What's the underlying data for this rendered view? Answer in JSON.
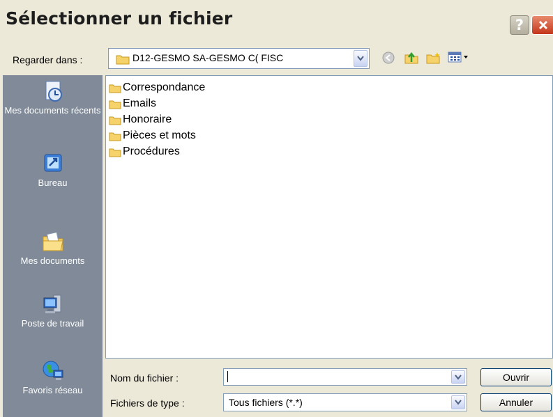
{
  "window": {
    "title": "Sélectionner un fichier"
  },
  "lookin": {
    "label": "Regarder dans :",
    "value": "D12-GESMO SA-GESMO  C( FISC"
  },
  "places": [
    {
      "label": "Mes documents récents",
      "icon": "recent-documents-icon"
    },
    {
      "label": "Bureau",
      "icon": "desktop-icon"
    },
    {
      "label": "Mes documents",
      "icon": "my-documents-icon"
    },
    {
      "label": "Poste de travail",
      "icon": "my-computer-icon"
    },
    {
      "label": "Favoris réseau",
      "icon": "network-places-icon"
    }
  ],
  "files": [
    {
      "name": "Correspondance",
      "icon": "folder-icon"
    },
    {
      "name": "Emails",
      "icon": "folder-icon"
    },
    {
      "name": "Honoraire",
      "icon": "folder-icon"
    },
    {
      "name": "Pièces et mots",
      "icon": "folder-icon"
    },
    {
      "name": "Procédures",
      "icon": "folder-icon"
    }
  ],
  "filename": {
    "label": "Nom du fichier :",
    "value": ""
  },
  "filetype": {
    "label": "Fichiers de type :",
    "value": "Tous fichiers (*.*)"
  },
  "buttons": {
    "open": "Ouvrir",
    "cancel": "Annuler",
    "help": "?"
  },
  "colors": {
    "places_bg": "#808a98",
    "dialog_bg": "#ece9d8",
    "close": "#c4361a",
    "folder": "#f5d36a"
  }
}
